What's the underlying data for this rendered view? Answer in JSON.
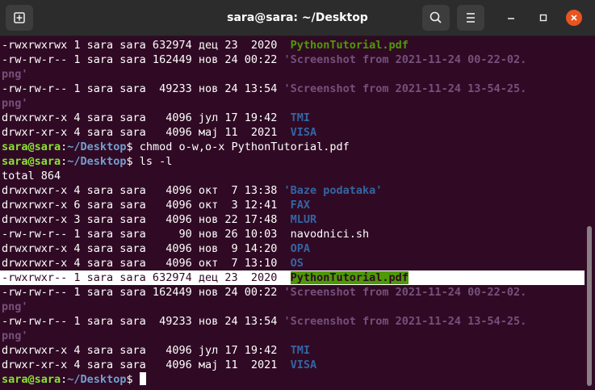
{
  "window": {
    "title": "sara@sara: ~/Desktop",
    "icons": {
      "new_tab": "new-tab-icon",
      "search": "search-icon",
      "menu": "hamburger-menu-icon",
      "minimize": "minimize-icon",
      "maximize": "maximize-icon",
      "close": "close-icon"
    }
  },
  "colors": {
    "background": "#300a24",
    "prompt_user": "#8ae234",
    "prompt_path": "#729fcf",
    "executable": "#4e9a06",
    "directory": "#3465a4",
    "quoted_name": "#75507b",
    "close_button": "#e95420"
  },
  "terminal": {
    "prompt_user": "sara@sara",
    "prompt_colon": ":",
    "prompt_path": "~/Desktop",
    "prompt_symbol": "$",
    "commands": [
      " chmod o-w,o-x PythonTutorial.pdf",
      " ls -l"
    ],
    "pre_lines": [
      {
        "meta": "-rwxrwxrwx 1 sara sara 632974 дец 23  2020  ",
        "name": "PythonTutorial.pdf"
      },
      {
        "meta": "-rw-rw-r-- 1 sara sara 162449 нов 24 00:22 ",
        "name": "'Screenshot from 2021-11-24 00-22-02."
      },
      {
        "name": "png'"
      },
      {
        "meta": "-rw-rw-r-- 1 sara sara  49233 нов 24 13:54 ",
        "name": "'Screenshot from 2021-11-24 13-54-25."
      },
      {
        "name": "png'"
      },
      {
        "meta": "drwxrwxr-x 4 sara sara   4096 јул 17 19:42  ",
        "name": "TMI"
      },
      {
        "meta": "drwxr-xr-x 4 sara sara   4096 мај 11  2021  ",
        "name": "VISA"
      }
    ],
    "total": "total 864",
    "listing": [
      {
        "meta": "drwxrwxr-x 4 sara sara   4096 окт  7 13:38 ",
        "name": "'Baze podataka'"
      },
      {
        "meta": "drwxrwxr-x 6 sara sara   4096 окт  3 12:41  ",
        "name": "FAX"
      },
      {
        "meta": "drwxrwxr-x 3 sara sara   4096 нов 22 17:48  ",
        "name": "MLUR"
      },
      {
        "meta": "-rw-rw-r-- 1 sara sara     90 нов 26 10:03  ",
        "name": "navodnici.sh"
      },
      {
        "meta": "drwxrwxr-x 4 sara sara   4096 нов  9 14:20  ",
        "name": "OPA"
      },
      {
        "meta": "drwxrwxr-x 4 sara sara   4096 окт  7 13:10  ",
        "name": "OS"
      },
      {
        "meta": "-rwxrwxr-- 1 sara sara 632974 дец 23  2020  ",
        "name": "PythonTutorial.pdf"
      },
      {
        "meta": "-rw-rw-r-- 1 sara sara 162449 нов 24 00:22 ",
        "name": "'Screenshot from 2021-11-24 00-22-02."
      },
      {
        "name": "png'"
      },
      {
        "meta": "-rw-rw-r-- 1 sara sara  49233 нов 24 13:54 ",
        "name": "'Screenshot from 2021-11-24 13-54-25."
      },
      {
        "name": "png'"
      },
      {
        "meta": "drwxrwxr-x 4 sara sara   4096 јул 17 19:42  ",
        "name": "TMI"
      },
      {
        "meta": "drwxr-xr-x 4 sara sara   4096 мај 11  2021  ",
        "name": "VISA"
      }
    ]
  }
}
